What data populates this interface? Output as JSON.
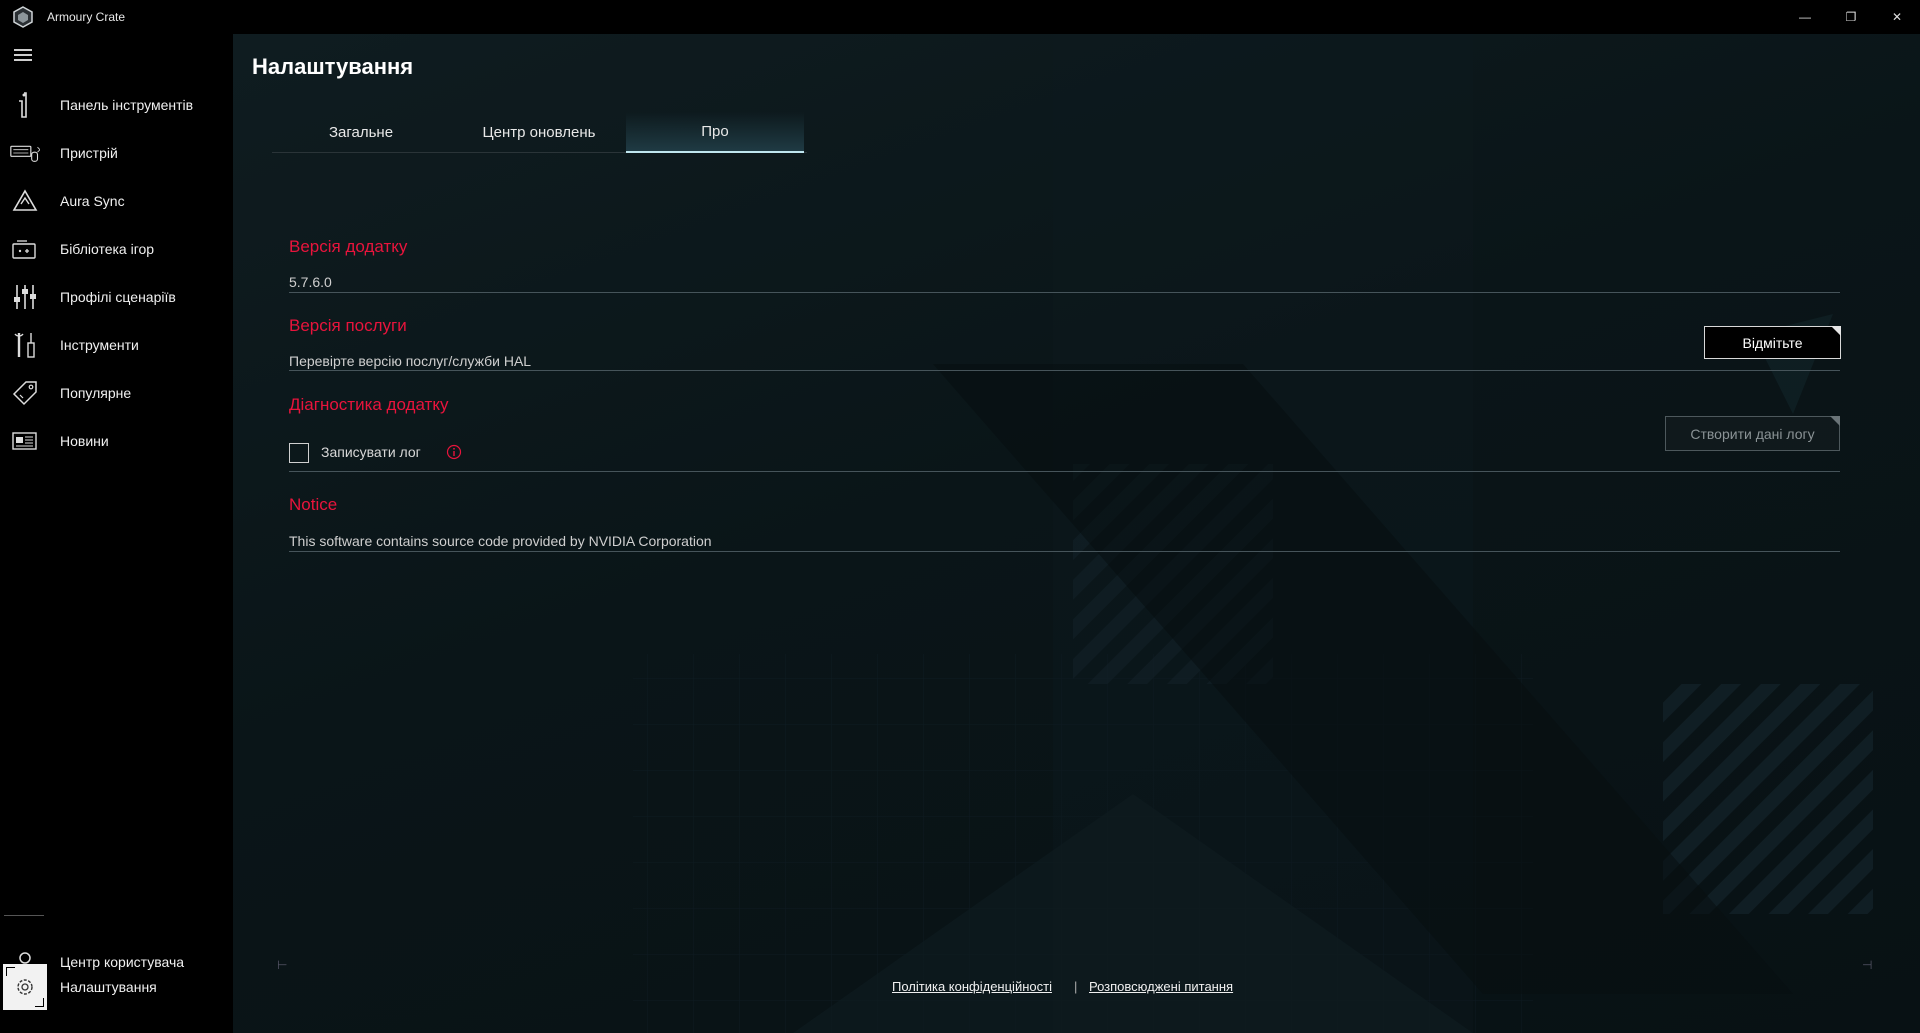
{
  "window": {
    "title": "Armoury Crate",
    "minimize_glyph": "—",
    "restore_glyph": "❐",
    "close_glyph": "✕"
  },
  "sidebar": {
    "items": [
      {
        "label": "Панель інструментів",
        "icon": "dashboard-icon"
      },
      {
        "label": "Пристрій",
        "icon": "keyboard-mouse-icon"
      },
      {
        "label": "Aura Sync",
        "icon": "aura-sync-icon"
      },
      {
        "label": "Бібліотека ігор",
        "icon": "game-library-icon"
      },
      {
        "label": "Профілі сценаріїв",
        "icon": "scenario-profiles-icon"
      },
      {
        "label": "Інструменти",
        "icon": "tools-icon"
      },
      {
        "label": "Популярне",
        "icon": "tag-icon"
      },
      {
        "label": "Новини",
        "icon": "news-icon"
      }
    ],
    "bottom_items": [
      {
        "label": "Центр користувача",
        "icon": "user-center-icon"
      },
      {
        "label": "Налаштування",
        "icon": "gear-icon",
        "active": true
      }
    ]
  },
  "page": {
    "title": "Налаштування",
    "tabs": [
      {
        "label": "Загальне",
        "active": false
      },
      {
        "label": "Центр оновлень",
        "active": false
      },
      {
        "label": "Про",
        "active": true
      }
    ]
  },
  "about": {
    "app_version_title": "Версія додатку",
    "app_version_value": "5.7.6.0",
    "service_version_title": "Версія послуги",
    "service_version_value": "Перевірте версію послуг/служби HAL",
    "check_button": "Відмітьте",
    "diagnostics_title": "Діагностика додатку",
    "log_checkbox_label": "Записувати лог",
    "log_checkbox_checked": false,
    "create_log_button": "Створити дані логу",
    "notice_title": "Notice",
    "notice_text": "This software contains source code provided by NVIDIA Corporation"
  },
  "footer": {
    "privacy_link": "Політика конфіденційності",
    "separator": "|",
    "faq_link": "Розповсюджені питання"
  },
  "colors": {
    "accent_red": "#e8143c",
    "tab_active_underline": "#bfe6ef"
  }
}
